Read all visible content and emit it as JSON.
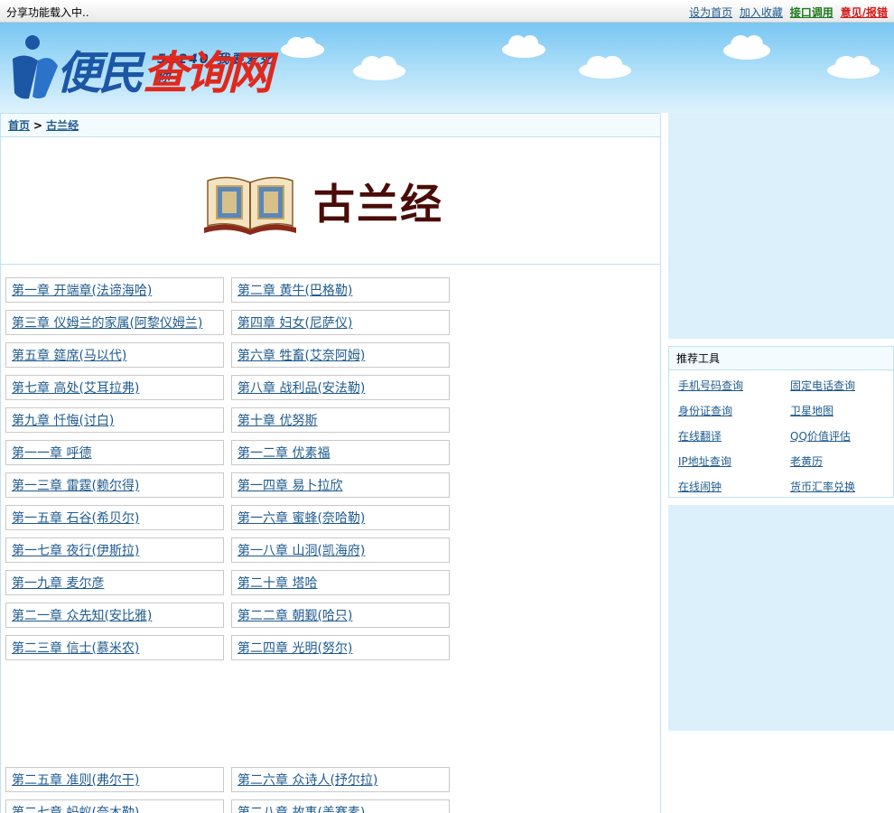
{
  "topbar": {
    "loading_text": "分享功能载入中..",
    "links": [
      "设为首页",
      "加入收藏",
      "接口调用",
      "意见/报错"
    ]
  },
  "header": {
    "slogan": "51240 我要爱死你",
    "logo_part1": "便民",
    "logo_part2": "查询网"
  },
  "breadcrumb": {
    "home": "首页",
    "separator": ">",
    "current": "古兰经"
  },
  "banner": {
    "title": "古兰经"
  },
  "chapters": [
    "第一章 开端章(法谛海哈)",
    "第二章 黄牛(巴格勒)",
    "第三章 仪姆兰的家属(阿黎仪姆兰)",
    "第四章 妇女(尼萨仪)",
    "第五章 筵席(马以代)",
    "第六章 牲畜(艾奈阿姆)",
    "第七章 高处(艾耳拉弗)",
    "第八章 战利品(安法勒)",
    "第九章 忏悔(讨白)",
    "第十章 优努斯",
    "第一一章 呼德",
    "第一二章 优素福",
    "第一三章 雷霆(赖尔得)",
    "第一四章 易卜拉欣",
    "第一五章 石谷(希贝尔)",
    "第一六章 蜜蜂(奈哈勒)",
    "第一七章 夜行(伊斯拉)",
    "第一八章 山洞(凯海府)",
    "第一九章 麦尔彦",
    "第二十章 塔哈",
    "第二一章 众先知(安比雅)",
    "第二二章 朝觐(哈只)",
    "第二三章 信士(慕米农)",
    "第二四章 光明(努尔)",
    "第二五章 准则(弗尔干)",
    "第二六章 众诗人(抒尔拉)",
    "第二七章 蚂蚁(奈木勒)",
    "第二八章 故事(盖赛素)"
  ],
  "tools": {
    "title": "推荐工具",
    "items": [
      "手机号码查询",
      "固定电话查询",
      "身份证查询",
      "卫星地图",
      "在线翻译",
      "QQ价值评估",
      "IP地址查询",
      "老黄历",
      "在线闹钟",
      "货币汇率兑换"
    ]
  },
  "colors": {
    "link": "#1f5b8f",
    "accent_green": "#1a7b1a",
    "accent_red": "#d11a1a",
    "border": "#bfe2f2",
    "ad_fill": "#dcf0fc"
  }
}
